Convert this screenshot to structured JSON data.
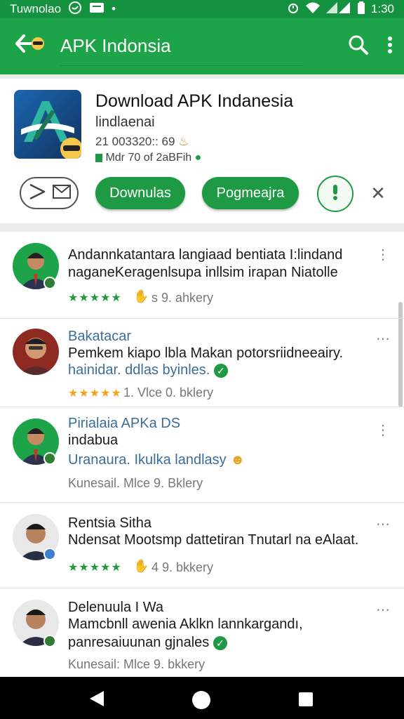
{
  "status_bar": {
    "left_text": "Tuwnolao",
    "time": "1:30",
    "icons": [
      "whatsapp-icon",
      "message-icon",
      "alarm-icon",
      "wifi-icon",
      "signal-icon",
      "battery-icon"
    ]
  },
  "app_bar": {
    "search_text": "APK Indonsia",
    "icons": [
      "back-arrow-icon",
      "search-icon",
      "more-vert-icon"
    ]
  },
  "app": {
    "title": "Download APK Indanesia",
    "subtitle": "lindlaenai",
    "meta1": "21 003320:: 69",
    "meta2": "Mdr 70 of 2aBFih",
    "buttons": {
      "primary": "Downulas",
      "secondary": "Pogmeajra"
    }
  },
  "reviews": [
    {
      "line1": "Andannkatantara langiaad bentiata I:lindand",
      "line2": "naganeKeragenlsupa inllsim irapan Niatolle",
      "line3": "",
      "stars": "★★★★★",
      "meta": "s 9. ahkery"
    },
    {
      "line1": "Bakatacar",
      "line2": "Pemkem kiapo lbla Makan potorsriidneeairy.",
      "line3": "hainidar. ddlas byinles.",
      "stars": "★★★★★",
      "meta": "1. Vlce 0. bklery"
    },
    {
      "line1": "Pirialaia APKa DS",
      "line2": "indabua",
      "line3": "Uranaura. Ikulka landlasy",
      "stars": "",
      "meta": "Kunesail. Mlce 9. Bklery"
    },
    {
      "line1": "Rentsia Sitha",
      "line2": "Ndensat Mootsmp dattetiran Tnutarl na eAlaat.",
      "line3": "",
      "stars": "★★★★★",
      "meta": "4 9. bkkery"
    },
    {
      "line1": "Delenuula I Wa",
      "line2": "Mamcbnll awenia Aklkn lannkargandı,",
      "line3": "panresaiuunan gjnales",
      "stars": "",
      "meta": "Kunesail: Mlce 9. bkkery"
    }
  ],
  "colors": {
    "primary_green": "#1ea448",
    "status_green": "#15923f",
    "button_green": "#1e9a45",
    "star_orange": "#f3a21c",
    "link_blue": "#3a6e98"
  }
}
